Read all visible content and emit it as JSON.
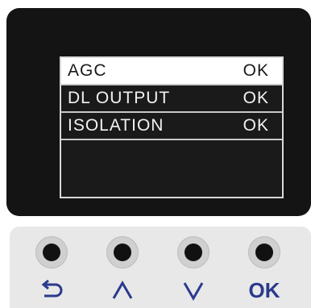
{
  "menu": {
    "items": [
      {
        "label": "AGC",
        "status": "OK"
      },
      {
        "label": "DL OUTPUT",
        "status": "OK"
      },
      {
        "label": "ISOLATION",
        "status": "OK"
      }
    ]
  },
  "keypad": {
    "ok_label": "OK",
    "accent_color": "#2a3a8c"
  },
  "icons": [
    "back-arrow-icon",
    "up-chevron-icon",
    "down-chevron-icon"
  ]
}
